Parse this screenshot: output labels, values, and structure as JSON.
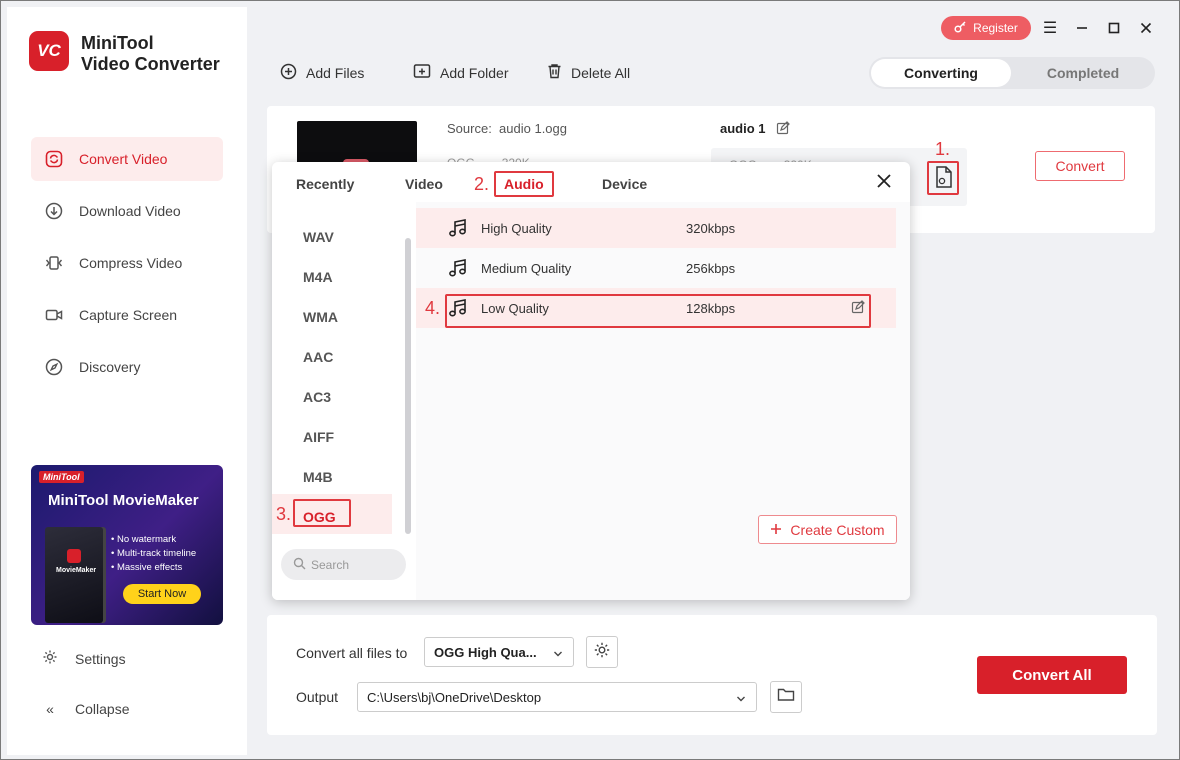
{
  "app": {
    "logo_text": "VC",
    "name_line1": "MiniTool",
    "name_line2": "Video Converter"
  },
  "sidebar": {
    "items": [
      {
        "label": "Convert Video",
        "icon": "convert-icon"
      },
      {
        "label": "Download Video",
        "icon": "download-icon"
      },
      {
        "label": "Compress Video",
        "icon": "compress-icon"
      },
      {
        "label": "Capture Screen",
        "icon": "capture-icon"
      },
      {
        "label": "Discovery",
        "icon": "compass-icon"
      }
    ],
    "promo": {
      "brand": "MiniTool",
      "title": "MiniTool MovieMaker",
      "box_label": "MovieMaker",
      "features": [
        "No watermark",
        "Multi-track timeline",
        "Massive effects"
      ],
      "cta": "Start Now"
    },
    "settings_label": "Settings",
    "collapse_label": "Collapse"
  },
  "topbar": {
    "register_label": "Register"
  },
  "toolbar": {
    "add_files": "Add Files",
    "add_folder": "Add Folder",
    "delete_all": "Delete All"
  },
  "tabs": {
    "converting": "Converting",
    "completed": "Completed"
  },
  "file": {
    "source_label": "Source:",
    "source_name": "audio 1.ogg",
    "source_meta": "OGG",
    "source_meta_2": "320K",
    "target_name": "audio 1",
    "target_meta": "OGG",
    "target_meta_2": "320K",
    "convert_label": "Convert"
  },
  "popup": {
    "tabs": [
      "Recently",
      "Video",
      "Audio",
      "Device"
    ],
    "selected_tab": "Audio",
    "formats": [
      "WAV",
      "M4A",
      "WMA",
      "AAC",
      "AC3",
      "AIFF",
      "M4B",
      "OGG"
    ],
    "selected_format": "OGG",
    "search_placeholder": "Search",
    "qualities": [
      {
        "name": "High Quality",
        "bitrate": "320kbps"
      },
      {
        "name": "Medium Quality",
        "bitrate": "256kbps"
      },
      {
        "name": "Low Quality",
        "bitrate": "128kbps"
      }
    ],
    "create_custom": "Create Custom"
  },
  "bottom": {
    "convert_all_to_label": "Convert all files to",
    "convert_all_to_value": "OGG High Qua...",
    "output_label": "Output",
    "output_value": "C:\\Users\\bj\\OneDrive\\Desktop",
    "convert_all": "Convert All"
  },
  "annotations": [
    "1.",
    "2.",
    "3.",
    "4."
  ],
  "colors": {
    "accent": "#d8202a",
    "accent_light": "#fdecec",
    "register": "#ee5d63"
  }
}
